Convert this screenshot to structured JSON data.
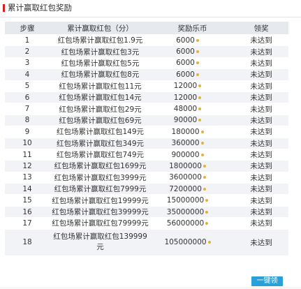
{
  "section": {
    "title": "累计赢取红包奖励"
  },
  "table": {
    "headers": [
      "步骤",
      "累计赢取红包（分）",
      "奖励乐币",
      "领奖"
    ],
    "rows": [
      {
        "step": "1",
        "desc": "红包场累计赢取红包1.9元",
        "coins": "6000",
        "status": "未达到"
      },
      {
        "step": "2",
        "desc": "红包场累计赢取红包3元",
        "coins": "6000",
        "status": "未达到"
      },
      {
        "step": "3",
        "desc": "红包场累计赢取红包5元",
        "coins": "6000",
        "status": "未达到"
      },
      {
        "step": "4",
        "desc": "红包场累计赢取红包8元",
        "coins": "6000",
        "status": "未达到"
      },
      {
        "step": "5",
        "desc": "红包场累计赢取红包11元",
        "coins": "12000",
        "status": "未达到"
      },
      {
        "step": "6",
        "desc": "红包场累计赢取红包14元",
        "coins": "12000",
        "status": "未达到"
      },
      {
        "step": "7",
        "desc": "红包场累计赢取红包29元",
        "coins": "48000",
        "status": "未达到"
      },
      {
        "step": "8",
        "desc": "红包场累计赢取红包69元",
        "coins": "90000",
        "status": "未达到"
      },
      {
        "step": "9",
        "desc": "红包场累计赢取红包149元",
        "coins": "180000",
        "status": "未达到"
      },
      {
        "step": "10",
        "desc": "红包场累计赢取红包349元",
        "coins": "360000",
        "status": "未达到"
      },
      {
        "step": "11",
        "desc": "红包场累计赢取红包749元",
        "coins": "900000",
        "status": "未达到"
      },
      {
        "step": "12",
        "desc": "红包场累计赢取红包1699元",
        "coins": "1800000",
        "status": "未达到"
      },
      {
        "step": "13",
        "desc": "红包场累计赢取红包3999元",
        "coins": "3600000",
        "status": "未达到"
      },
      {
        "step": "14",
        "desc": "红包场累计赢取红包7999元",
        "coins": "7200000",
        "status": "未达到"
      },
      {
        "step": "15",
        "desc": "红包场累计赢取红包19999元",
        "coins": "15000000",
        "status": "未达到"
      },
      {
        "step": "16",
        "desc": "红包场累计赢取红包39999元",
        "coins": "35000000",
        "status": "未达到"
      },
      {
        "step": "17",
        "desc": "红包场累计赢取红包79999元",
        "coins": "56000000",
        "status": "未达到"
      },
      {
        "step": "18",
        "desc": "红包场累计赢取红包139999元",
        "coins": "105000000",
        "status": "未达到"
      }
    ],
    "coin_icon": "coin-icon",
    "coin_color": "#e3b23c"
  },
  "claim_button": {
    "label": "一键领"
  },
  "colors": {
    "accent_bar": "#d92020",
    "button_bg": "#2aa0d8",
    "header_bg": "#e6e9ee",
    "row_alt_bg": "#f1f3f6"
  }
}
